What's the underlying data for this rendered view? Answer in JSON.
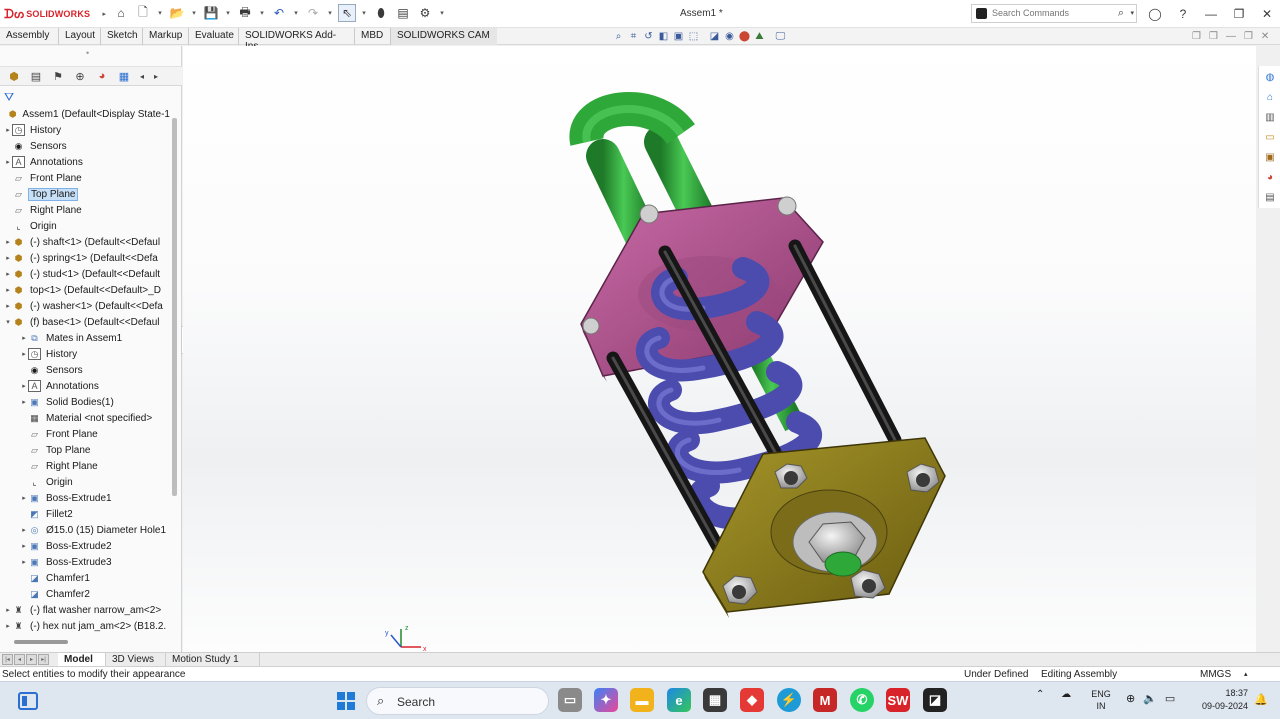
{
  "app": {
    "logo_text": "SOLIDWORKS",
    "window_title": "Assem1 *"
  },
  "search": {
    "placeholder": "Search Commands"
  },
  "ribbon_tabs": [
    "Assembly",
    "Layout",
    "Sketch",
    "Markup",
    "Evaluate",
    "SOLIDWORKS Add-Ins",
    "MBD",
    "SOLIDWORKS CAM"
  ],
  "tree": [
    {
      "text": "Assem1  (Default<Display State-1",
      "icon": "assembly-icon",
      "indent": 0,
      "exp": ""
    },
    {
      "text": "History",
      "icon": "history-icon",
      "indent": 1,
      "exp": "▸"
    },
    {
      "text": "Sensors",
      "icon": "sensor-icon",
      "indent": 1,
      "exp": ""
    },
    {
      "text": "Annotations",
      "icon": "annotation-icon",
      "indent": 1,
      "exp": "▸"
    },
    {
      "text": "Front Plane",
      "icon": "plane-icon",
      "indent": 1,
      "exp": ""
    },
    {
      "text": "Top Plane",
      "icon": "plane-icon",
      "indent": 1,
      "exp": "",
      "selected": true
    },
    {
      "text": "Right Plane",
      "icon": "plane-icon",
      "indent": 1,
      "exp": ""
    },
    {
      "text": "Origin",
      "icon": "origin-icon",
      "indent": 1,
      "exp": ""
    },
    {
      "text": "(-) shaft<1> (Default<<Defaul",
      "icon": "part-icon",
      "indent": 1,
      "exp": "▸"
    },
    {
      "text": "(-) spring<1> (Default<<Defa",
      "icon": "part-icon",
      "indent": 1,
      "exp": "▸"
    },
    {
      "text": "(-) stud<1> (Default<<Default",
      "icon": "part-icon",
      "indent": 1,
      "exp": "▸"
    },
    {
      "text": "top<1> (Default<<Default>_D",
      "icon": "part-icon",
      "indent": 1,
      "exp": "▸"
    },
    {
      "text": "(-) washer<1> (Default<<Defa",
      "icon": "part-icon",
      "indent": 1,
      "exp": "▸"
    },
    {
      "text": "(f) base<1> (Default<<Defaul",
      "icon": "part-icon",
      "indent": 1,
      "exp": "▾"
    },
    {
      "text": "Mates in Assem1",
      "icon": "mates-icon",
      "indent": 2,
      "exp": "▸"
    },
    {
      "text": "History",
      "icon": "history-icon",
      "indent": 2,
      "exp": "▸"
    },
    {
      "text": "Sensors",
      "icon": "sensor-icon",
      "indent": 2,
      "exp": ""
    },
    {
      "text": "Annotations",
      "icon": "annotation-icon",
      "indent": 2,
      "exp": "▸"
    },
    {
      "text": "Solid Bodies(1)",
      "icon": "solid-bodies-icon",
      "indent": 2,
      "exp": "▸"
    },
    {
      "text": "Material <not specified>",
      "icon": "material-icon",
      "indent": 2,
      "exp": ""
    },
    {
      "text": "Front Plane",
      "icon": "plane-icon",
      "indent": 2,
      "exp": ""
    },
    {
      "text": "Top Plane",
      "icon": "plane-icon",
      "indent": 2,
      "exp": ""
    },
    {
      "text": "Right Plane",
      "icon": "plane-icon",
      "indent": 2,
      "exp": ""
    },
    {
      "text": "Origin",
      "icon": "origin-icon",
      "indent": 2,
      "exp": ""
    },
    {
      "text": "Boss-Extrude1",
      "icon": "extrude-icon",
      "indent": 2,
      "exp": "▸"
    },
    {
      "text": "Fillet2",
      "icon": "fillet-icon",
      "indent": 2,
      "exp": ""
    },
    {
      "text": "Ø15.0 (15) Diameter Hole1",
      "icon": "hole-icon",
      "indent": 2,
      "exp": "▸"
    },
    {
      "text": "Boss-Extrude2",
      "icon": "extrude-icon",
      "indent": 2,
      "exp": "▸"
    },
    {
      "text": "Boss-Extrude3",
      "icon": "extrude-icon",
      "indent": 2,
      "exp": "▸"
    },
    {
      "text": "Chamfer1",
      "icon": "chamfer-icon",
      "indent": 2,
      "exp": ""
    },
    {
      "text": "Chamfer2",
      "icon": "chamfer-icon",
      "indent": 2,
      "exp": ""
    },
    {
      "text": "(-) flat washer narrow_am<2>",
      "icon": "toolbox-icon",
      "indent": 1,
      "exp": "▸"
    },
    {
      "text": "(-) hex nut jam_am<2> (B18.2.",
      "icon": "toolbox-icon",
      "indent": 1,
      "exp": "▸"
    }
  ],
  "bottom_tabs": [
    "Model",
    "3D Views",
    "Motion Study 1"
  ],
  "status": {
    "message": "Select entities to modify their appearance",
    "definition": "Under Defined",
    "mode": "Editing Assembly",
    "units": "MMGS"
  },
  "taskbar": {
    "search_label": "Search",
    "lang_line1": "ENG",
    "lang_line2": "IN",
    "time": "18:37",
    "date": "09-09-2024"
  },
  "triad": {
    "x": "x",
    "y": "y",
    "z": "z"
  },
  "colors": {
    "shaft": "#2fa83a",
    "top_plate": "#b2508f",
    "spring": "#4c4cae",
    "stud": "#1a1a1a",
    "base": "#8a7a1a",
    "nut": "#cfcfcf",
    "accent": "#d8232a"
  }
}
